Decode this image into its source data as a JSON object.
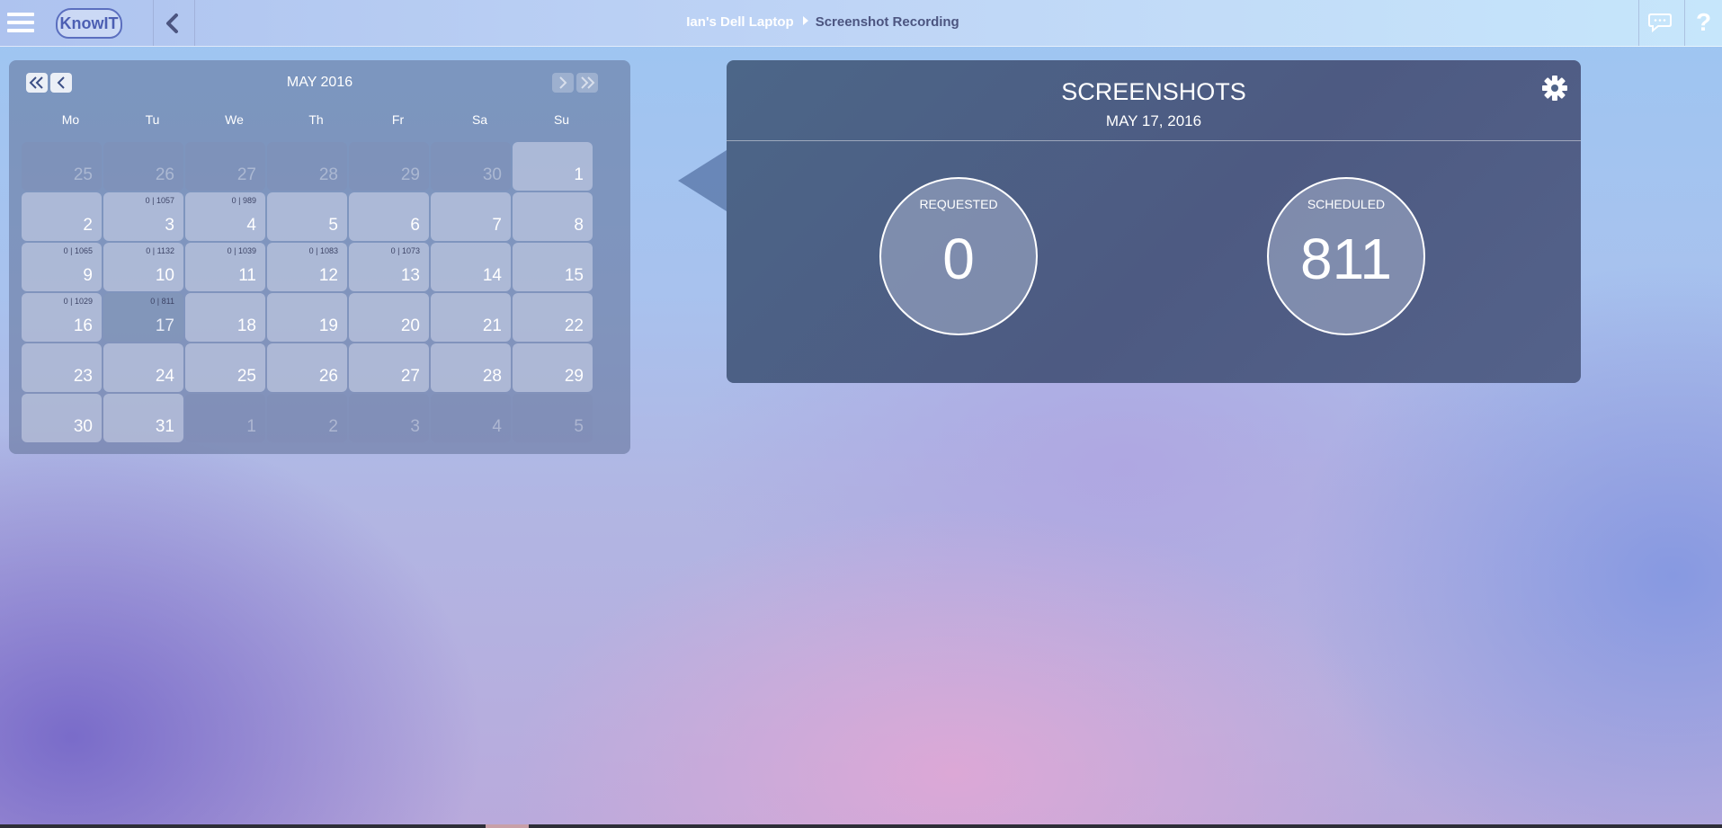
{
  "header": {
    "logo_text": "KnowIT",
    "device": "Ian's Dell Laptop",
    "page": "Screenshot Recording",
    "help_label": "?"
  },
  "calendar": {
    "title": "MAY 2016",
    "weekdays": [
      "Mo",
      "Tu",
      "We",
      "Th",
      "Fr",
      "Sa",
      "Su"
    ],
    "days": [
      {
        "n": "25",
        "other": true
      },
      {
        "n": "26",
        "other": true
      },
      {
        "n": "27",
        "other": true
      },
      {
        "n": "28",
        "other": true
      },
      {
        "n": "29",
        "other": true
      },
      {
        "n": "30",
        "other": true
      },
      {
        "n": "1"
      },
      {
        "n": "2"
      },
      {
        "n": "3",
        "c": "0 | 1057"
      },
      {
        "n": "4",
        "c": "0 | 989"
      },
      {
        "n": "5"
      },
      {
        "n": "6"
      },
      {
        "n": "7"
      },
      {
        "n": "8"
      },
      {
        "n": "9",
        "c": "0 | 1065"
      },
      {
        "n": "10",
        "c": "0 | 1132"
      },
      {
        "n": "11",
        "c": "0 | 1039"
      },
      {
        "n": "12",
        "c": "0 | 1083"
      },
      {
        "n": "13",
        "c": "0 | 1073"
      },
      {
        "n": "14"
      },
      {
        "n": "15"
      },
      {
        "n": "16",
        "c": "0 | 1029"
      },
      {
        "n": "17",
        "c": "0 | 811",
        "selected": true
      },
      {
        "n": "18"
      },
      {
        "n": "19"
      },
      {
        "n": "20"
      },
      {
        "n": "21"
      },
      {
        "n": "22"
      },
      {
        "n": "23"
      },
      {
        "n": "24"
      },
      {
        "n": "25"
      },
      {
        "n": "26"
      },
      {
        "n": "27"
      },
      {
        "n": "28"
      },
      {
        "n": "29"
      },
      {
        "n": "30"
      },
      {
        "n": "31"
      },
      {
        "n": "1",
        "other": true
      },
      {
        "n": "2",
        "other": true
      },
      {
        "n": "3",
        "other": true
      },
      {
        "n": "4",
        "other": true
      },
      {
        "n": "5",
        "other": true
      }
    ]
  },
  "screenshots": {
    "title": "SCREENSHOTS",
    "date": "MAY 17, 2016",
    "requested_label": "REQUESTED",
    "requested_value": "0",
    "scheduled_label": "SCHEDULED",
    "scheduled_value": "811"
  },
  "colors": {
    "panel": "#4d5a82",
    "accent": "#4c5fb3"
  }
}
